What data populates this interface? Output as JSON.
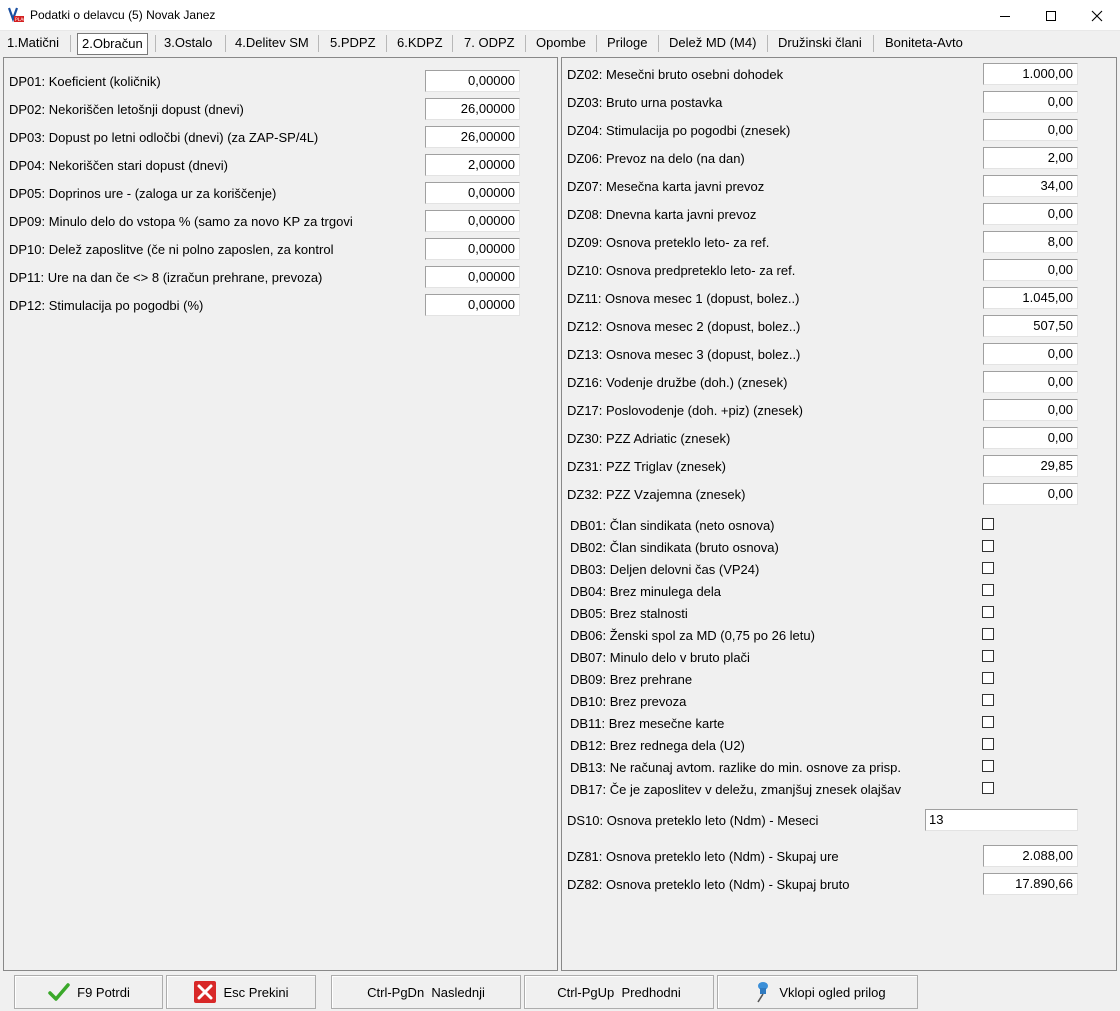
{
  "window": {
    "title": "Podatki o delavcu (5) Novak Janez"
  },
  "tabs": [
    {
      "label": "1.Matični"
    },
    {
      "label": "2.Obračun"
    },
    {
      "label": "3.Ostalo"
    },
    {
      "label": "4.Delitev SM"
    },
    {
      "label": "5.PDPZ"
    },
    {
      "label": "6.KDPZ"
    },
    {
      "label": "7. ODPZ"
    },
    {
      "label": "Opombe"
    },
    {
      "label": "Priloge"
    },
    {
      "label": "Delež MD (M4)"
    },
    {
      "label": "Družinski člani"
    },
    {
      "label": "Boniteta-Avto"
    }
  ],
  "left_fields": [
    {
      "label": "DP01: Koeficient (količnik)",
      "value": "0,00000"
    },
    {
      "label": "DP02: Nekoriščen letošnji dopust (dnevi)",
      "value": "26,00000"
    },
    {
      "label": "DP03: Dopust po letni odločbi (dnevi) (za ZAP-SP/4L)",
      "value": "26,00000"
    },
    {
      "label": "DP04: Nekoriščen stari dopust (dnevi)",
      "value": "2,00000"
    },
    {
      "label": "DP05: Doprinos ure - (zaloga ur za koriščenje)",
      "value": "0,00000"
    },
    {
      "label": "DP09: Minulo delo do vstopa % (samo za novo KP za trgovi",
      "value": "0,00000"
    },
    {
      "label": "DP10: Delež zaposlitve (če ni polno zaposlen, za kontrol",
      "value": "0,00000"
    },
    {
      "label": "DP11: Ure na dan če <> 8 (izračun prehrane, prevoza)",
      "value": "0,00000"
    },
    {
      "label": "DP12: Stimulacija po pogodbi (%)",
      "value": "0,00000"
    }
  ],
  "right_fields": [
    {
      "label": "DZ02: Mesečni bruto osebni dohodek",
      "value": "1.000,00"
    },
    {
      "label": "DZ03: Bruto urna postavka",
      "value": "0,00"
    },
    {
      "label": "DZ04: Stimulacija po pogodbi (znesek)",
      "value": "0,00"
    },
    {
      "label": "DZ06: Prevoz na delo (na dan)",
      "value": "2,00"
    },
    {
      "label": "DZ07: Mesečna karta javni prevoz",
      "value": "34,00"
    },
    {
      "label": "DZ08: Dnevna karta javni prevoz",
      "value": "0,00"
    },
    {
      "label": "DZ09: Osnova preteklo leto- za ref.",
      "value": "8,00"
    },
    {
      "label": "DZ10: Osnova predpreteklo leto- za ref.",
      "value": "0,00"
    },
    {
      "label": "DZ11: Osnova mesec 1 (dopust, bolez..)",
      "value": "1.045,00"
    },
    {
      "label": "DZ12: Osnova mesec 2 (dopust, bolez..)",
      "value": "507,50"
    },
    {
      "label": "DZ13: Osnova mesec 3 (dopust, bolez..)",
      "value": "0,00"
    },
    {
      "label": "DZ16: Vodenje družbe (doh.) (znesek)",
      "value": "0,00"
    },
    {
      "label": "DZ17: Poslovodenje (doh. +piz) (znesek)",
      "value": "0,00"
    },
    {
      "label": "DZ30: PZZ Adriatic (znesek)",
      "value": "0,00"
    },
    {
      "label": "DZ31: PZZ Triglav (znesek)",
      "value": "29,85"
    },
    {
      "label": "DZ32: PZZ Vzajemna (znesek)",
      "value": "0,00"
    }
  ],
  "checkboxes": [
    {
      "label": "DB01: Član sindikata (neto osnova)",
      "checked": false
    },
    {
      "label": "DB02: Član sindikata (bruto osnova)",
      "checked": false
    },
    {
      "label": "DB03: Deljen delovni čas (VP24)",
      "checked": false
    },
    {
      "label": "DB04: Brez minulega dela",
      "checked": false
    },
    {
      "label": "DB05: Brez stalnosti",
      "checked": false
    },
    {
      "label": "DB06: Ženski spol za MD (0,75 po 26 letu)",
      "checked": false
    },
    {
      "label": "DB07: Minulo delo v bruto plači",
      "checked": false
    },
    {
      "label": "DB09: Brez prehrane",
      "checked": false
    },
    {
      "label": "DB10: Brez prevoza",
      "checked": false
    },
    {
      "label": "DB11: Brez mesečne karte",
      "checked": false
    },
    {
      "label": "DB12: Brez rednega dela (U2)",
      "checked": false
    },
    {
      "label": "DB13: Ne računaj avtom. razlike do min. osnove za prisp.",
      "checked": false
    },
    {
      "label": "DB17: Če je zaposlitev v deležu, zmanjšuj znesek olajšav",
      "checked": false
    }
  ],
  "ds10": {
    "label": "DS10: Osnova preteklo leto (Ndm) - Meseci",
    "value": "13"
  },
  "dz81": {
    "label": "DZ81: Osnova preteklo leto (Ndm) - Skupaj ure",
    "value": "2.088,00"
  },
  "dz82": {
    "label": "DZ82: Osnova preteklo leto (Ndm) - Skupaj bruto",
    "value": "17.890,66"
  },
  "buttons": {
    "confirm": "F9 Potrdi",
    "cancel": "Esc Prekini",
    "next": "Ctrl-PgDn  Naslednji",
    "prev": "Ctrl-PgUp  Predhodni",
    "attachments": "Vklopi ogled prilog"
  },
  "icons": {
    "app": "app-logo-icon",
    "minimize": "minimize-icon",
    "maximize": "maximize-icon",
    "close": "close-icon",
    "confirm": "checkmark-icon",
    "cancel": "red-x-icon",
    "attachments": "pushpin-icon"
  }
}
